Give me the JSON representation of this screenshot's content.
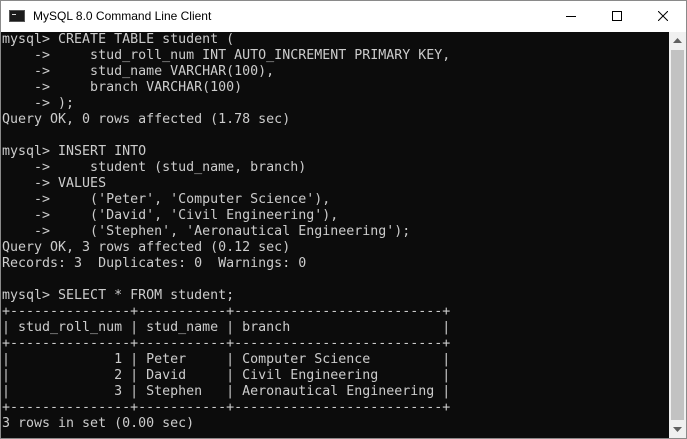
{
  "window": {
    "title": "MySQL 8.0 Command Line Client",
    "icon": "console-icon",
    "controls": [
      "minimize-icon",
      "maximize-icon",
      "close-icon"
    ]
  },
  "terminal": {
    "lines": [
      "mysql> CREATE TABLE student (",
      "    ->     stud_roll_num INT AUTO_INCREMENT PRIMARY KEY,",
      "    ->     stud_name VARCHAR(100),",
      "    ->     branch VARCHAR(100)",
      "    -> );",
      "Query OK, 0 rows affected (1.78 sec)",
      "",
      "mysql> INSERT INTO",
      "    ->     student (stud_name, branch)",
      "    -> VALUES",
      "    ->     ('Peter', 'Computer Science'),",
      "    ->     ('David', 'Civil Engineering'),",
      "    ->     ('Stephen', 'Aeronautical Engineering');",
      "Query OK, 3 rows affected (0.12 sec)",
      "Records: 3  Duplicates: 0  Warnings: 0",
      "",
      "mysql> SELECT * FROM student;",
      "+---------------+-----------+--------------------------+",
      "| stud_roll_num | stud_name | branch                   |",
      "+---------------+-----------+--------------------------+",
      "|             1 | Peter     | Computer Science         |",
      "|             2 | David     | Civil Engineering        |",
      "|             3 | Stephen   | Aeronautical Engineering |",
      "+---------------+-----------+--------------------------+",
      "3 rows in set (0.00 sec)",
      ""
    ]
  },
  "colors": {
    "terminal_bg": "#0c0c0c",
    "terminal_fg": "#cccccc",
    "titlebar_bg": "#ffffff"
  }
}
